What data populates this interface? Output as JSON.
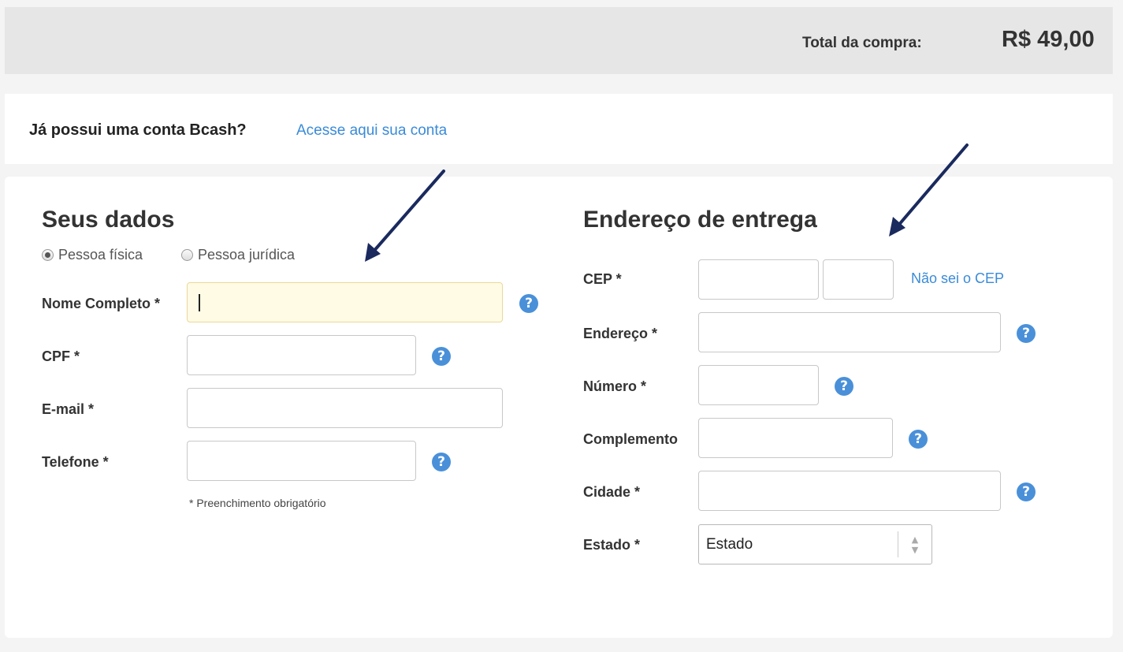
{
  "header": {
    "total_label": "Total da compra:",
    "total_value": "R$ 49,00"
  },
  "account": {
    "question": "Já possui uma conta Bcash?",
    "link": "Acesse aqui sua conta"
  },
  "personal": {
    "title": "Seus dados",
    "person_types": [
      {
        "label": "Pessoa física",
        "checked": true
      },
      {
        "label": "Pessoa jurídica",
        "checked": false
      }
    ],
    "fields": {
      "nome": {
        "label": "Nome Completo *",
        "value": ""
      },
      "cpf": {
        "label": "CPF *",
        "value": ""
      },
      "email": {
        "label": "E-mail *",
        "value": ""
      },
      "telefone": {
        "label": "Telefone *",
        "value": ""
      }
    },
    "note": "* Preenchimento obrigatório"
  },
  "address": {
    "title": "Endereço de entrega",
    "fields": {
      "cep": {
        "label": "CEP *",
        "value": ""
      },
      "endereco": {
        "label": "Endereço *",
        "value": ""
      },
      "numero": {
        "label": "Número *",
        "value": ""
      },
      "complemento": {
        "label": "Complemento",
        "value": ""
      },
      "cidade": {
        "label": "Cidade *",
        "value": ""
      },
      "estado": {
        "label": "Estado *",
        "selected": "Estado"
      }
    },
    "cep_link": "Não sei o CEP"
  },
  "icons": {
    "help": "?",
    "help_color": "#4a90d9",
    "annotation_arrow_color": "#1a2a5e"
  }
}
